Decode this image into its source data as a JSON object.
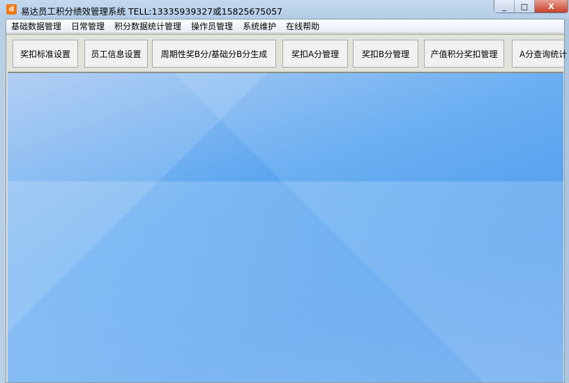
{
  "window": {
    "icon": "d",
    "title": "易达员工积分绩效管理系统 TELL:13335939327或15825675057",
    "minimize": "_",
    "maximize": "□",
    "close": "X"
  },
  "menu": [
    "基础数据管理",
    "日常管理",
    "积分数据统计管理",
    "操作员管理",
    "系统维护",
    "在线帮助"
  ],
  "toolbar": [
    "奖扣标准设置",
    "员工信息设置",
    "周期性奖B分/基础分B分生成",
    "奖扣A分管理",
    "奖扣B分管理",
    "产值积分奖扣管理",
    "A分查询统计"
  ]
}
